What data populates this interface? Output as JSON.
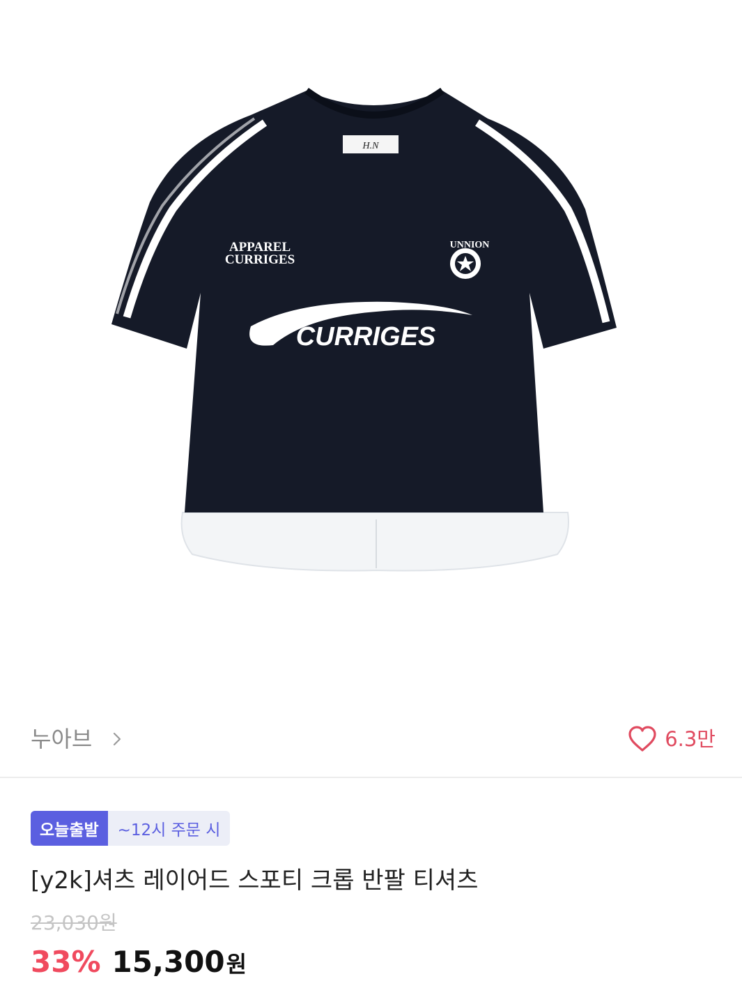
{
  "product_image": {
    "alt": "t-shirt-photo",
    "label_tag": "H.N",
    "print_small_line1": "APPAREL",
    "print_small_line2": "CURRIGES",
    "print_main": "CURRIGES",
    "badge_text": "UNNION",
    "colors": {
      "shirt": "#151a28",
      "stripe": "#ffffff",
      "hem": "#f3f5f7"
    }
  },
  "store": {
    "name": "누아브",
    "chevron_icon": "chevron-right-icon"
  },
  "like": {
    "icon": "heart-outline-icon",
    "count": "6.3만",
    "color": "#e04a5f"
  },
  "badges": {
    "primary": "오늘출발",
    "secondary": "~12시 주문 시",
    "color": "#5b5fe0"
  },
  "product": {
    "title": "[y2k]셔츠 레이어드 스포티 크롭 반팔 티셔츠",
    "original_price": "23,030원",
    "discount": "33%",
    "sale_price": "15,300",
    "currency": "원"
  }
}
